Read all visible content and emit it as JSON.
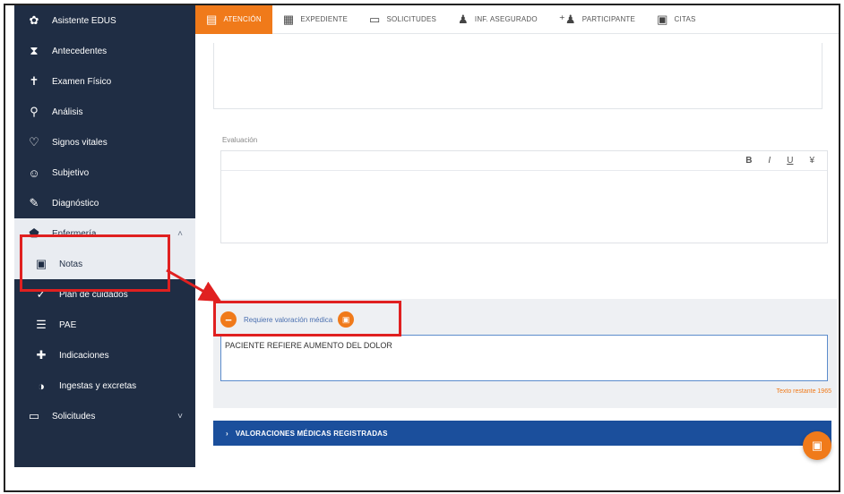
{
  "sidebar": {
    "items": [
      {
        "label": "Asistente EDUS",
        "icon": "gear-icon"
      },
      {
        "label": "Antecedentes",
        "icon": "hourglass-icon"
      },
      {
        "label": "Examen Físico",
        "icon": "person-icon"
      },
      {
        "label": "Análisis",
        "icon": "search-icon"
      },
      {
        "label": "Signos vitales",
        "icon": "heart-icon"
      },
      {
        "label": "Subjetivo",
        "icon": "smile-icon"
      },
      {
        "label": "Diagnóstico",
        "icon": "pen-icon"
      },
      {
        "label": "Enfermería",
        "icon": "location-pin-icon"
      },
      {
        "label": "Notas",
        "icon": "document-icon"
      },
      {
        "label": "Plan de cuidados",
        "icon": "check-icon"
      },
      {
        "label": "PAE",
        "icon": "list-icon"
      },
      {
        "label": "Indicaciones",
        "icon": "medical-kit-icon"
      },
      {
        "label": "Ingestas y excretas",
        "icon": "drop-icon"
      },
      {
        "label": "Solicitudes",
        "icon": "monitor-icon"
      }
    ]
  },
  "tabs": [
    {
      "label": "ATENCIÓN",
      "icon": "list-icon",
      "active": true
    },
    {
      "label": "EXPEDIENTE",
      "icon": "id-card-icon",
      "active": false
    },
    {
      "label": "SOLICITUDES",
      "icon": "monitor-icon",
      "active": false
    },
    {
      "label": "INF. ASEGURADO",
      "icon": "person-icon",
      "active": false
    },
    {
      "label": "PARTICIPANTE",
      "icon": "add-group-icon",
      "active": false
    },
    {
      "label": "CITAS",
      "icon": "calendar-icon",
      "active": false
    }
  ],
  "main": {
    "evaluacion_label": "Evaluación",
    "editor_toolbar": {
      "bold": "B",
      "italic": "I",
      "underline": "U",
      "clear": "¥"
    },
    "requiere_label": "Requiere valoración médica",
    "nota_value": "PACIENTE REFIERE AUMENTO DEL DOLOR",
    "counter_text": "Texto restante 1965",
    "banner_label": "VALORACIONES MÉDICAS REGISTRADAS"
  },
  "colors": {
    "accent": "#f07a1a",
    "sidebar_bg": "#1f2d44",
    "banner_bg": "#1b4f9c",
    "annotation_red": "#e02020"
  }
}
